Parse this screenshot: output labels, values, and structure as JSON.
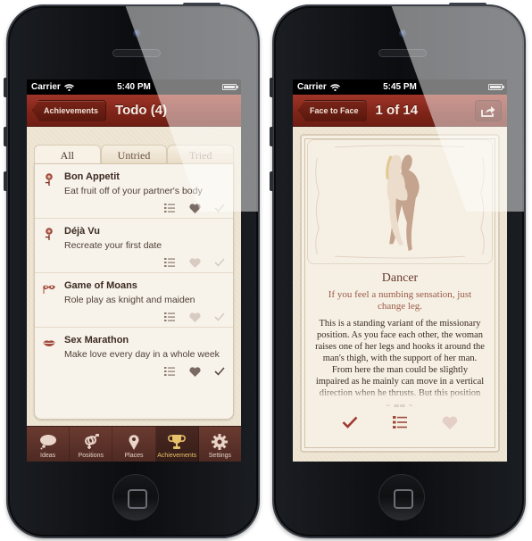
{
  "left_phone": {
    "status": {
      "carrier": "Carrier",
      "time": "5:40 PM"
    },
    "navbar": {
      "back_label": "Achievements",
      "title": "Todo (4)"
    },
    "tabs": [
      {
        "label": "All",
        "state": "active"
      },
      {
        "label": "Untried",
        "state": "normal"
      },
      {
        "label": "Tried",
        "state": "dim"
      }
    ],
    "items": [
      {
        "icon": "rose-icon",
        "title": "Bon Appetit",
        "desc": "Eat fruit off of your partner's body",
        "favorited": true,
        "tried": false
      },
      {
        "icon": "rose-icon",
        "title": "Déjà Vu",
        "desc": "Recreate your first date",
        "favorited": false,
        "tried": false
      },
      {
        "icon": "mask-icon",
        "title": "Game of Moans",
        "desc": "Role play as knight and maiden",
        "favorited": false,
        "tried": false
      },
      {
        "icon": "lips-icon",
        "title": "Sex Marathon",
        "desc": "Make love every day in a whole week",
        "favorited": true,
        "tried": true
      }
    ],
    "tabbar": [
      {
        "label": "Ideas",
        "icon": "thought-bubble-icon",
        "active": false
      },
      {
        "label": "Positions",
        "icon": "gender-symbols-icon",
        "active": false
      },
      {
        "label": "Places",
        "icon": "map-pin-icon",
        "active": false
      },
      {
        "label": "Achievements",
        "icon": "trophy-icon",
        "active": true
      },
      {
        "label": "Settings",
        "icon": "gear-icon",
        "active": false
      }
    ]
  },
  "right_phone": {
    "status": {
      "carrier": "Carrier",
      "time": "5:45 PM"
    },
    "navbar": {
      "back_label": "Face to Face",
      "title": "1 of 14",
      "share_icon": "share-icon"
    },
    "position": {
      "name": "Dancer",
      "tip": "If you feel a numbing sensation, just change leg.",
      "description": "This is a standing variant of the missionary position. As you face each other, the woman raises one of her legs and hooks it around the man's thigh, with the support of her man. From here the man could be slightly impaired as he mainly can move in a vertical direction when he thrusts. But this position has the",
      "ornament": "~ ∞∞ ~",
      "tried": true,
      "favorited": false
    }
  },
  "colors": {
    "navbar_red": "#8a2c20",
    "parchment": "#efe6d4",
    "tabbar_brown": "#5a3028",
    "accent_gold": "#e8c26a",
    "check_red": "#a03a30"
  }
}
